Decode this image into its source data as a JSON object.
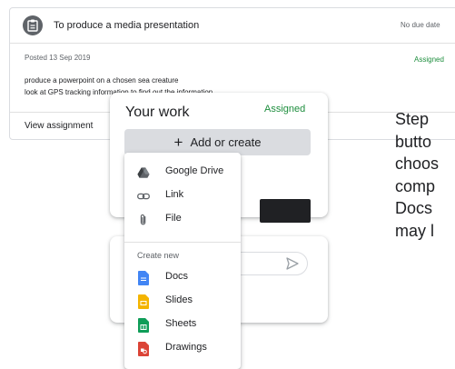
{
  "assignment": {
    "title": "To produce a media presentation",
    "due": "No due date",
    "posted": "Posted 13 Sep 2019",
    "status": "Assigned",
    "description_lines": [
      "produce a powerpoint on a chosen sea creature",
      "look at GPS tracking information to find out the information"
    ],
    "view_link": "View assignment"
  },
  "your_work": {
    "title": "Your work",
    "status": "Assigned",
    "add_button": "Add or create"
  },
  "menu": {
    "items": [
      {
        "label": "Google Drive",
        "icon": "google-drive-icon"
      },
      {
        "label": "Link",
        "icon": "link-icon"
      },
      {
        "label": "File",
        "icon": "paperclip-icon"
      }
    ],
    "section_label": "Create new",
    "create_items": [
      {
        "label": "Docs",
        "icon": "docs-icon",
        "color": "#4285f4"
      },
      {
        "label": "Slides",
        "icon": "slides-icon",
        "color": "#f4b400"
      },
      {
        "label": "Sheets",
        "icon": "sheets-icon",
        "color": "#0f9d58"
      },
      {
        "label": "Drawings",
        "icon": "drawings-icon",
        "color": "#db4437"
      }
    ]
  },
  "side_text": {
    "lines": [
      "Step",
      "butto",
      "choos",
      "comp",
      "Docs",
      "may l"
    ]
  },
  "colors": {
    "accent_green": "#1e8e3e",
    "button_gray": "#dadce0"
  }
}
